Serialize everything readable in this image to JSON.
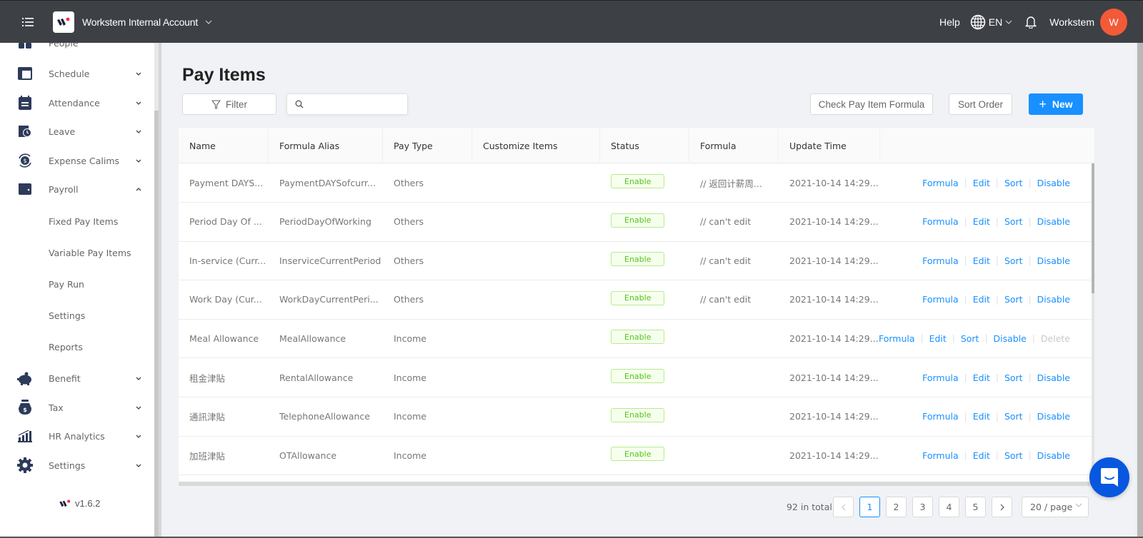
{
  "topbar": {
    "account_name": "Workstem Internal Account",
    "help_label": "Help",
    "language": "EN",
    "username": "Workstem",
    "avatar_initial": "W",
    "avatar_color": "#f25a38"
  },
  "sidebar": {
    "items": [
      {
        "label": "People",
        "icon": "people-icon",
        "expandable": false
      },
      {
        "label": "Schedule",
        "icon": "schedule-icon",
        "expandable": true,
        "expanded": false
      },
      {
        "label": "Attendance",
        "icon": "calendar-icon",
        "expandable": true,
        "expanded": false
      },
      {
        "label": "Leave",
        "icon": "leave-clock-icon",
        "expandable": true,
        "expanded": false
      },
      {
        "label": "Expense Calims",
        "icon": "expense-icon",
        "expandable": true,
        "expanded": false
      },
      {
        "label": "Payroll",
        "icon": "wallet-icon",
        "expandable": true,
        "expanded": true
      },
      {
        "label": "Benefit",
        "icon": "piggy-bank-icon",
        "expandable": true,
        "expanded": false
      },
      {
        "label": "Tax",
        "icon": "money-bag-icon",
        "expandable": true,
        "expanded": false
      },
      {
        "label": "HR Analytics",
        "icon": "analytics-icon",
        "expandable": true,
        "expanded": false
      },
      {
        "label": "Settings",
        "icon": "gear-icon",
        "expandable": true,
        "expanded": false
      }
    ],
    "payroll_subitems": [
      {
        "label": "Fixed Pay Items"
      },
      {
        "label": "Variable Pay Items"
      },
      {
        "label": "Pay Run"
      },
      {
        "label": "Settings"
      },
      {
        "label": "Reports"
      }
    ],
    "version": "v1.6.2"
  },
  "page": {
    "title": "Pay Items",
    "filter_label": "Filter",
    "search_placeholder": "",
    "search_value": "",
    "check_formula_label": "Check Pay Item Formula",
    "sort_order_label": "Sort Order",
    "new_label": "New",
    "accent_color": "#1890ff"
  },
  "table": {
    "columns": [
      "Name",
      "Formula Alias",
      "Pay Type",
      "Customize Items",
      "Status",
      "Formula",
      "Update Time",
      ""
    ],
    "rows": [
      {
        "name": "Payment DAYS...",
        "alias": "PaymentDAYSofcurr...",
        "pay_type": "Others",
        "customize": "",
        "status": "Enable",
        "formula": "// 返回计薪周...",
        "update_time": "2021-10-14 14:29...",
        "actions": [
          "Formula",
          "Edit",
          "Sort",
          "Disable"
        ]
      },
      {
        "name": "Period Day Of ...",
        "alias": "PeriodDayOfWorking",
        "pay_type": "Others",
        "customize": "",
        "status": "Enable",
        "formula": "// can't edit",
        "update_time": "2021-10-14 14:29...",
        "actions": [
          "Formula",
          "Edit",
          "Sort",
          "Disable"
        ]
      },
      {
        "name": "In-service (Curr...",
        "alias": "InserviceCurrentPeriod",
        "pay_type": "Others",
        "customize": "",
        "status": "Enable",
        "formula": "// can't edit",
        "update_time": "2021-10-14 14:29...",
        "actions": [
          "Formula",
          "Edit",
          "Sort",
          "Disable"
        ]
      },
      {
        "name": "Work Day (Cur...",
        "alias": "WorkDayCurrentPeri...",
        "pay_type": "Others",
        "customize": "",
        "status": "Enable",
        "formula": "// can't edit",
        "update_time": "2021-10-14 14:29...",
        "actions": [
          "Formula",
          "Edit",
          "Sort",
          "Disable"
        ]
      },
      {
        "name": "Meal Allowance",
        "alias": "MealAllowance",
        "pay_type": "Income",
        "customize": "",
        "status": "Enable",
        "formula": "",
        "update_time": "2021-10-14 14:29...",
        "actions": [
          "Formula",
          "Edit",
          "Sort",
          "Disable",
          "Delete"
        ]
      },
      {
        "name": "租金津貼",
        "alias": "RentalAllowance",
        "pay_type": "Income",
        "customize": "",
        "status": "Enable",
        "formula": "",
        "update_time": "2021-10-14 14:29...",
        "actions": [
          "Formula",
          "Edit",
          "Sort",
          "Disable"
        ]
      },
      {
        "name": "通訊津貼",
        "alias": "TelephoneAllowance",
        "pay_type": "Income",
        "customize": "",
        "status": "Enable",
        "formula": "",
        "update_time": "2021-10-14 14:29...",
        "actions": [
          "Formula",
          "Edit",
          "Sort",
          "Disable"
        ]
      },
      {
        "name": "加班津貼",
        "alias": "OTAllowance",
        "pay_type": "Income",
        "customize": "",
        "status": "Enable",
        "formula": "",
        "update_time": "2021-10-14 14:29...",
        "actions": [
          "Formula",
          "Edit",
          "Sort",
          "Disable"
        ]
      }
    ],
    "status_color": "#52c41a"
  },
  "pagination": {
    "total_label": "92 in total",
    "pages": [
      "1",
      "2",
      "3",
      "4",
      "5"
    ],
    "current_page": "1",
    "prev_label": "<",
    "next_label": ">",
    "page_size_label": "20 / page"
  }
}
